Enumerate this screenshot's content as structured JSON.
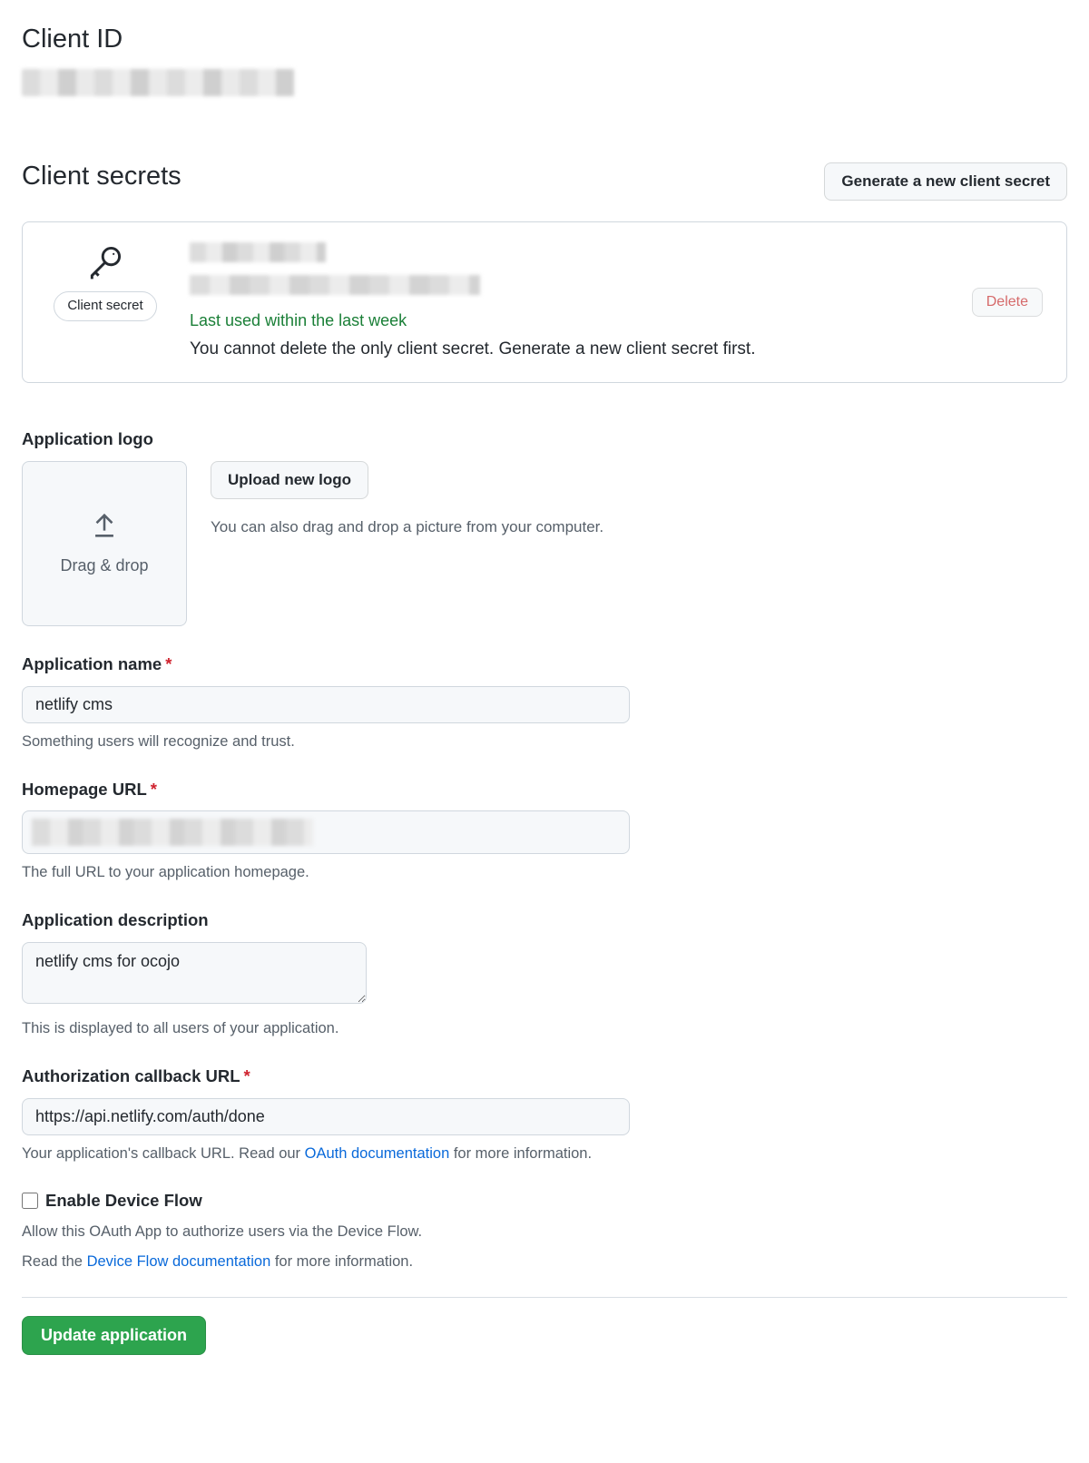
{
  "client_id": {
    "heading": "Client ID"
  },
  "client_secrets": {
    "heading": "Client secrets",
    "generate_button": "Generate a new client secret",
    "pill_label": "Client secret",
    "last_used": "Last used within the last week",
    "no_delete_msg": "You cannot delete the only client secret. Generate a new client secret first.",
    "delete_button": "Delete"
  },
  "app_logo": {
    "label": "Application logo",
    "upload_button": "Upload new logo",
    "drop_label": "Drag & drop",
    "hint": "You can also drag and drop a picture from your computer."
  },
  "app_name": {
    "label": "Application name",
    "value": "netlify cms",
    "help": "Something users will recognize and trust."
  },
  "homepage_url": {
    "label": "Homepage URL",
    "help": "The full URL to your application homepage."
  },
  "app_desc": {
    "label": "Application description",
    "value": "netlify cms for ocojo",
    "help": "This is displayed to all users of your application."
  },
  "callback_url": {
    "label": "Authorization callback URL",
    "value": "https://api.netlify.com/auth/done",
    "help_prefix": "Your application's callback URL. Read our ",
    "help_link": "OAuth documentation",
    "help_suffix": " for more information."
  },
  "device_flow": {
    "label": "Enable Device Flow",
    "help1": "Allow this OAuth App to authorize users via the Device Flow.",
    "help2_prefix": "Read the ",
    "help2_link": "Device Flow documentation",
    "help2_suffix": " for more information."
  },
  "submit": {
    "label": "Update application"
  }
}
